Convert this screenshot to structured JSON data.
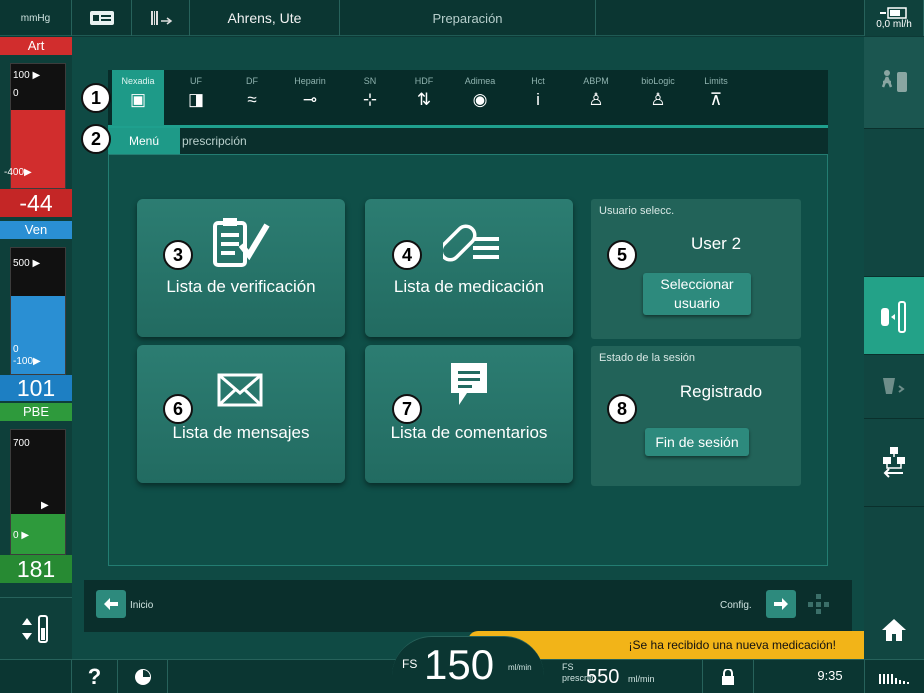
{
  "topbar": {
    "unit": "mmHg",
    "patient_name": "Ahrens, Ute",
    "phase": "Preparación",
    "uf_rate": "0,0",
    "uf_rate_unit": "ml/h"
  },
  "pressures": {
    "art": {
      "label": "Art",
      "tick_top": "100",
      "tick_zero": "0",
      "tick_bottom": "-400",
      "value": "-44",
      "color": "#d12d2d"
    },
    "ven": {
      "label": "Ven",
      "tick_top": "500",
      "tick_zero": "0",
      "tick_bottom": "-100",
      "value": "101",
      "color": "#2a8fd3"
    },
    "pbe": {
      "label": "PBE",
      "tick_top": "700",
      "tick_zero": "0",
      "value": "181",
      "color": "#2e9a3c"
    }
  },
  "tabs": [
    {
      "label": "Nexadia",
      "icon": "nexadia-icon",
      "glyph": "▣",
      "active": true
    },
    {
      "label": "UF",
      "icon": "uf-icon",
      "glyph": "◨"
    },
    {
      "label": "DF",
      "icon": "df-wave-icon",
      "glyph": "≈"
    },
    {
      "label": "Heparin",
      "icon": "heparin-syringe-icon",
      "glyph": "⊸"
    },
    {
      "label": "SN",
      "icon": "single-needle-icon",
      "glyph": "⊹"
    },
    {
      "label": "HDF",
      "icon": "hdf-icon",
      "glyph": "⇅"
    },
    {
      "label": "Adimea",
      "icon": "adimea-signal-icon",
      "glyph": "◉"
    },
    {
      "label": "Hct",
      "icon": "hct-icon",
      "glyph": "i"
    },
    {
      "label": "ABPM",
      "icon": "abpm-person-icon",
      "glyph": "♙"
    },
    {
      "label": "bioLogic",
      "icon": "biologic-icon",
      "glyph": "♙"
    },
    {
      "label": "Limits",
      "icon": "limits-icon",
      "glyph": "⊼"
    }
  ],
  "subtabs": {
    "active": "Menú",
    "inactive": "prescripción"
  },
  "buttons": {
    "checklist": "Lista de verificación",
    "medication": "Lista de medicación",
    "messages": "Lista de mensajes",
    "comments": "Lista de comentarios"
  },
  "user_box": {
    "header": "Usuario selecc.",
    "user": "User 2",
    "select_button_line1": "Seleccionar",
    "select_button_line2": "usuario"
  },
  "session_box": {
    "header": "Estado de la sesión",
    "status": "Registrado",
    "logout_button": "Fin de sesión"
  },
  "navbar": {
    "back_label": "Inicio",
    "config_label": "Config."
  },
  "notification": "¡Se ha recibido una nueva medicación!",
  "bottombar": {
    "help": "?",
    "fs_label": "FS",
    "fs_value": "150",
    "fs_unit": "ml/min",
    "fs_prescribed_label1": "FS",
    "fs_prescribed_label2": "prescrito",
    "fs_prescribed_value": "550",
    "fs_prescribed_unit": "ml/min",
    "time": "9:35"
  },
  "callouts": [
    "1",
    "2",
    "3",
    "4",
    "5",
    "6",
    "7",
    "8"
  ]
}
